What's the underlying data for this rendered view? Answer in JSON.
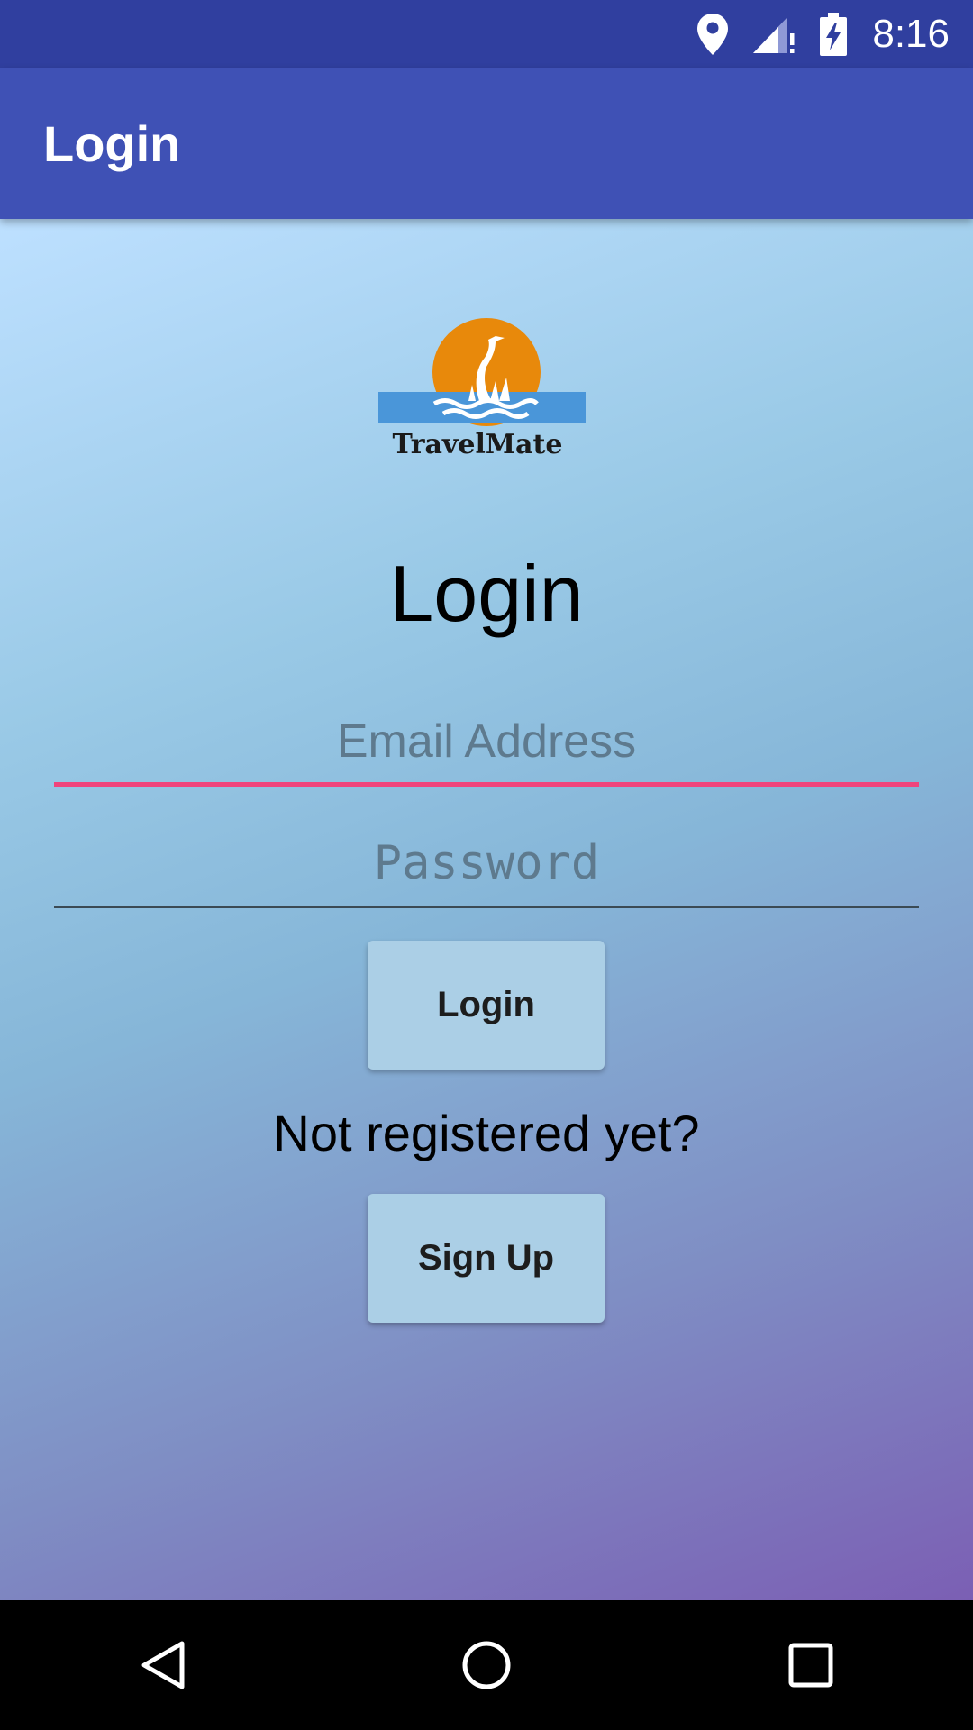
{
  "status_bar": {
    "time": "8:16",
    "icons": [
      "location-icon",
      "signal-icon",
      "battery-charging-icon"
    ]
  },
  "app_bar": {
    "title": "Login"
  },
  "logo": {
    "name": "travelmate-logo",
    "text": "TravelMate"
  },
  "form": {
    "heading": "Login",
    "email_placeholder": "Email Address",
    "password_placeholder": "Password",
    "login_button": "Login",
    "register_prompt": "Not registered yet?",
    "signup_button": "Sign Up"
  },
  "nav_bar": {
    "icons": [
      "back-icon",
      "home-icon",
      "recents-icon"
    ]
  },
  "colors": {
    "status_bar": "#303f9f",
    "app_bar": "#3f51b5",
    "accent_underline": "#f0447c",
    "button": "#abcfe6"
  }
}
